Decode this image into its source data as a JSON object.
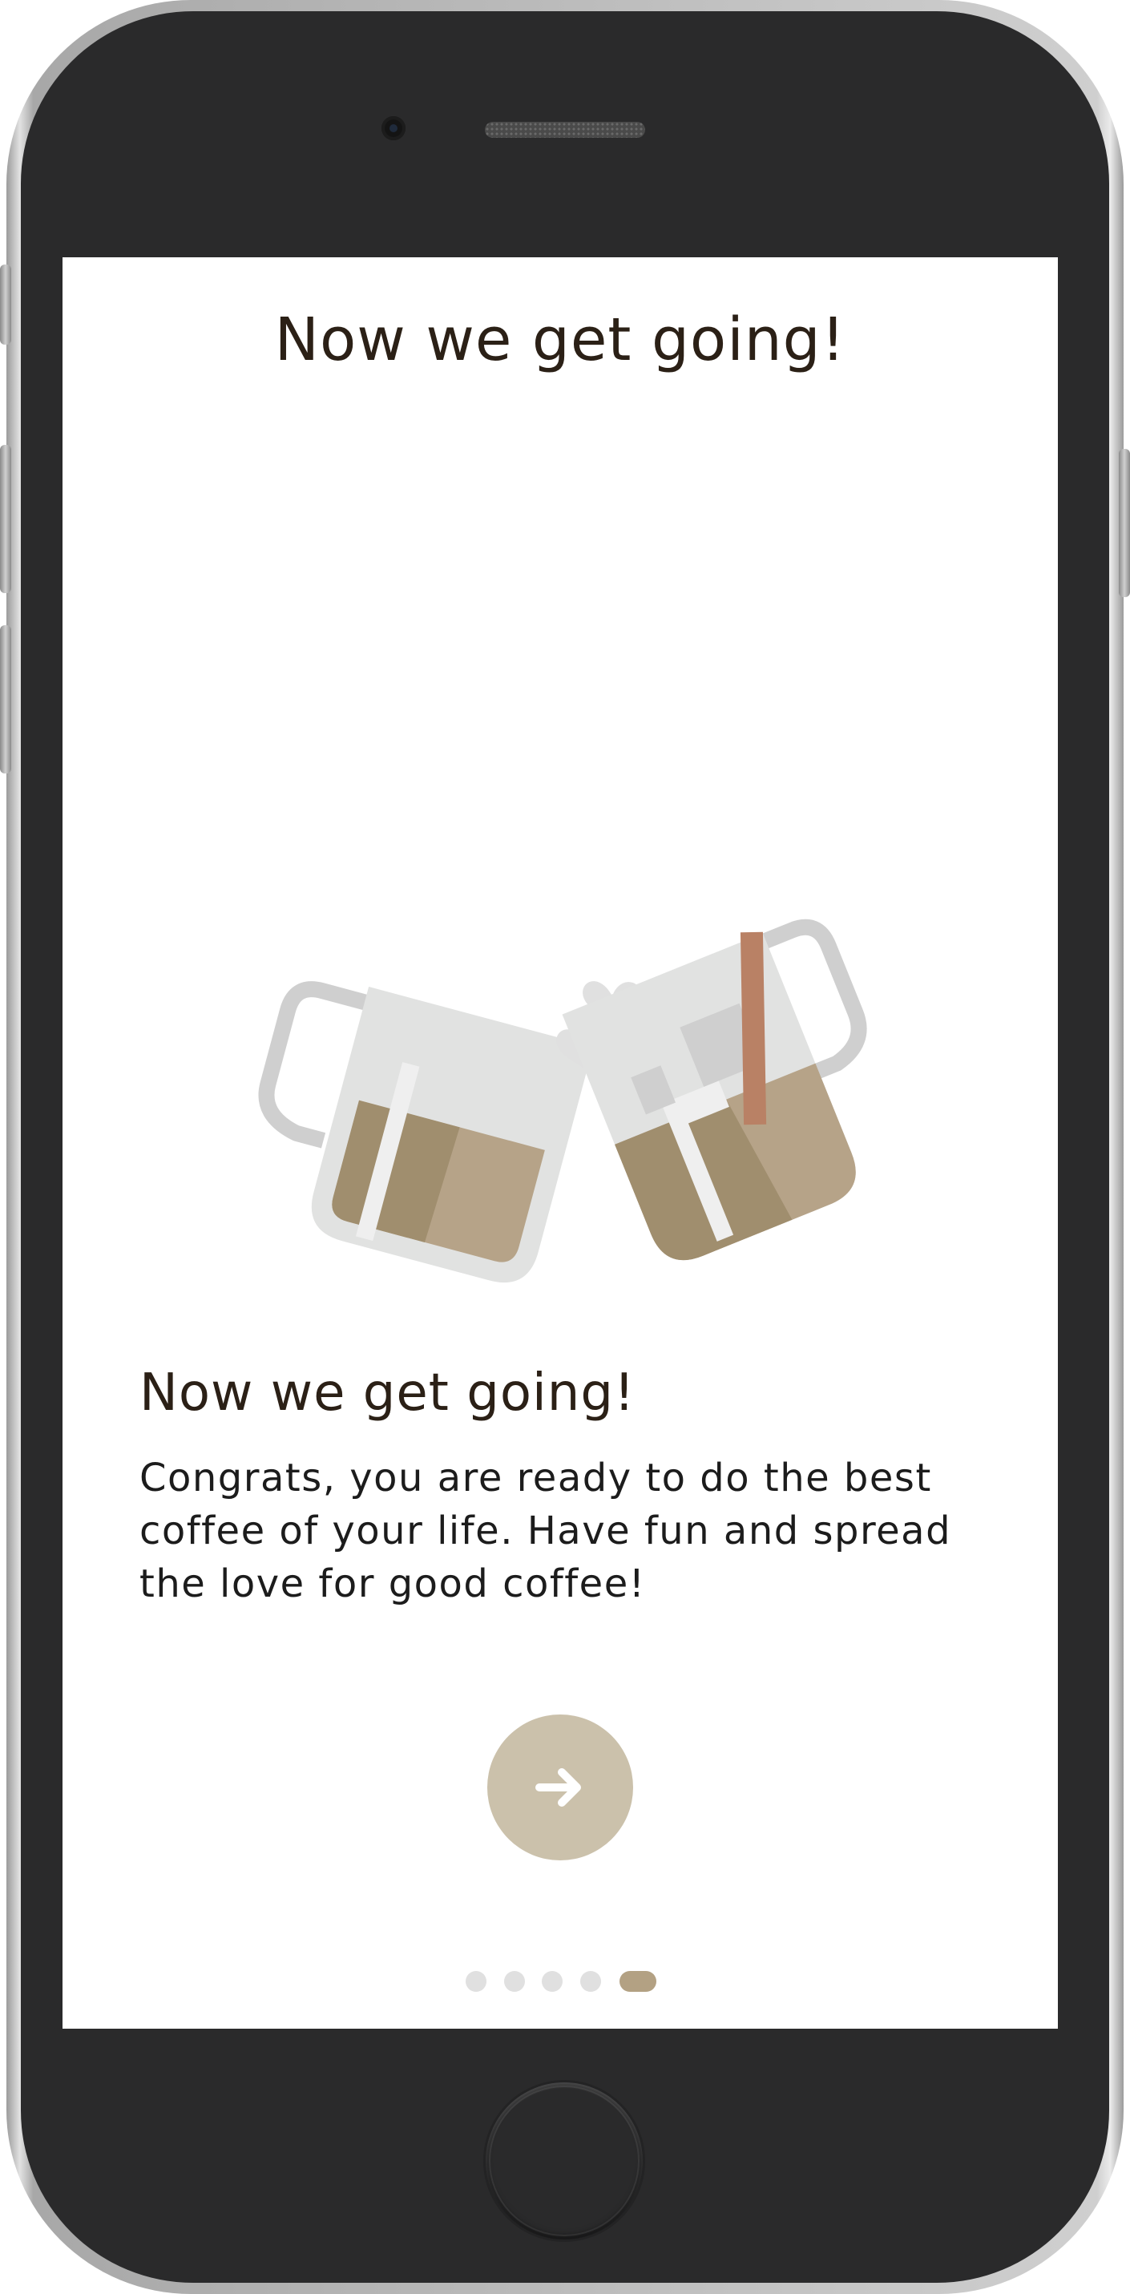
{
  "screen": {
    "title": "Now we get going!",
    "heading": "Now we get going!",
    "body": "Congrats, you are ready to do the best coffee of your life. Have fun and spread the love for good coffee!",
    "next_button": {
      "icon": "arrow-right-icon",
      "accent": "#cbc1ab"
    },
    "illustration": {
      "name": "two-coffee-mugs-cheers-illustration",
      "colors": {
        "coffee_dark": "#a08e6e",
        "coffee_light": "#b6a388",
        "glass": "#e1e2e1",
        "handle": "#cfcfcf",
        "stirrer": "#b98165",
        "hearts": "#e0e0e0"
      }
    },
    "pagination": {
      "total": 5,
      "current": 5,
      "active_color": "#b3a183",
      "inactive_color": "#e0e0e0"
    }
  },
  "device": {
    "frame": "iphone",
    "frame_color": "#2a2a2b"
  }
}
